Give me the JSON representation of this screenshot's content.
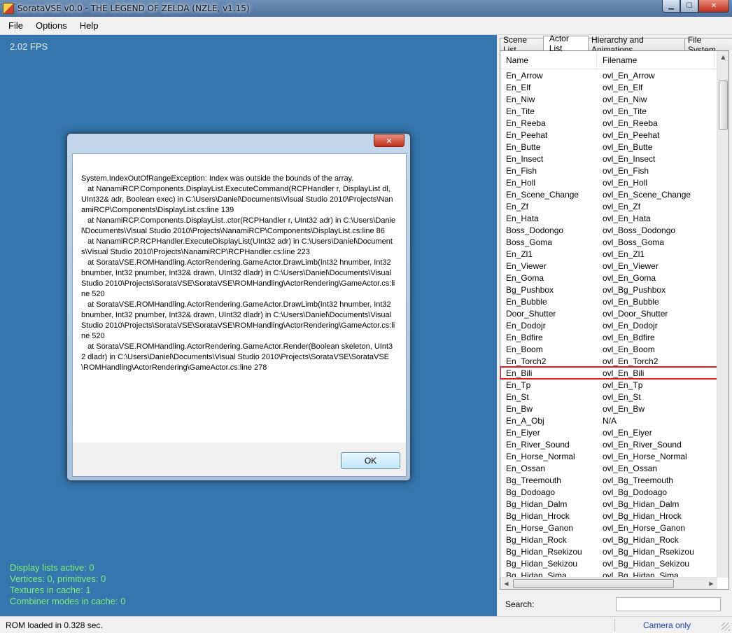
{
  "window": {
    "title": "SorataVSE v0.0 - THE LEGEND OF ZELDA (NZLE, v1.15)"
  },
  "menu": [
    "File",
    "Options",
    "Help"
  ],
  "viewport": {
    "fps": "2.02 FPS",
    "stats": [
      "Display lists active: 0",
      "Vertices: 0, primitives: 0",
      "Textures in cache: 1",
      "Combiner modes in cache: 0"
    ]
  },
  "tabs": [
    "Scene List",
    "Actor List",
    "Hierarchy and Animations",
    "File System"
  ],
  "active_tab": "Actor List",
  "actor_list": {
    "columns": [
      "Name",
      "Filename"
    ],
    "highlighted_row": "En_Bili",
    "rows": [
      [
        "En_Arrow",
        "ovl_En_Arrow"
      ],
      [
        "En_Elf",
        "ovl_En_Elf"
      ],
      [
        "En_Niw",
        "ovl_En_Niw"
      ],
      [
        "En_Tite",
        "ovl_En_Tite"
      ],
      [
        "En_Reeba",
        "ovl_En_Reeba"
      ],
      [
        "En_Peehat",
        "ovl_En_Peehat"
      ],
      [
        "En_Butte",
        "ovl_En_Butte"
      ],
      [
        "En_Insect",
        "ovl_En_Insect"
      ],
      [
        "En_Fish",
        "ovl_En_Fish"
      ],
      [
        "En_Holl",
        "ovl_En_Holl"
      ],
      [
        "En_Scene_Change",
        "ovl_En_Scene_Change"
      ],
      [
        "En_Zf",
        "ovl_En_Zf"
      ],
      [
        "En_Hata",
        "ovl_En_Hata"
      ],
      [
        "Boss_Dodongo",
        "ovl_Boss_Dodongo"
      ],
      [
        "Boss_Goma",
        "ovl_Boss_Goma"
      ],
      [
        "En_Zl1",
        "ovl_En_Zl1"
      ],
      [
        "En_Viewer",
        "ovl_En_Viewer"
      ],
      [
        "En_Goma",
        "ovl_En_Goma"
      ],
      [
        "Bg_Pushbox",
        "ovl_Bg_Pushbox"
      ],
      [
        "En_Bubble",
        "ovl_En_Bubble"
      ],
      [
        "Door_Shutter",
        "ovl_Door_Shutter"
      ],
      [
        "En_Dodojr",
        "ovl_En_Dodojr"
      ],
      [
        "En_Bdfire",
        "ovl_En_Bdfire"
      ],
      [
        "En_Boom",
        "ovl_En_Boom"
      ],
      [
        "En_Torch2",
        "ovl_En_Torch2"
      ],
      [
        "En_Bili",
        "ovl_En_Bili"
      ],
      [
        "En_Tp",
        "ovl_En_Tp"
      ],
      [
        "En_St",
        "ovl_En_St"
      ],
      [
        "En_Bw",
        "ovl_En_Bw"
      ],
      [
        "En_A_Obj",
        "N/A"
      ],
      [
        "En_Eiyer",
        "ovl_En_Eiyer"
      ],
      [
        "En_River_Sound",
        "ovl_En_River_Sound"
      ],
      [
        "En_Horse_Normal",
        "ovl_En_Horse_Normal"
      ],
      [
        "En_Ossan",
        "ovl_En_Ossan"
      ],
      [
        "Bg_Treemouth",
        "ovl_Bg_Treemouth"
      ],
      [
        "Bg_Dodoago",
        "ovl_Bg_Dodoago"
      ],
      [
        "Bg_Hidan_Dalm",
        "ovl_Bg_Hidan_Dalm"
      ],
      [
        "Bg_Hidan_Hrock",
        "ovl_Bg_Hidan_Hrock"
      ],
      [
        "En_Horse_Ganon",
        "ovl_En_Horse_Ganon"
      ],
      [
        "Bg_Hidan_Rock",
        "ovl_Bg_Hidan_Rock"
      ],
      [
        "Bg_Hidan_Rsekizou",
        "ovl_Bg_Hidan_Rsekizou"
      ],
      [
        "Bg_Hidan_Sekizou",
        "ovl_Bg_Hidan_Sekizou"
      ],
      [
        "Bg_Hidan_Sima",
        "ovl_Bg_Hidan_Sima"
      ]
    ]
  },
  "search": {
    "label": "Search:",
    "value": ""
  },
  "status": {
    "left": "ROM loaded in 0.328 sec.",
    "right": "Camera only"
  },
  "dialog": {
    "message": "System.IndexOutOfRangeException: Index was outside the bounds of the array.\n   at NanamiRCP.Components.DisplayList.ExecuteCommand(RCPHandler r, DisplayList dl, UInt32& adr, Boolean exec) in C:\\Users\\Daniel\\Documents\\Visual Studio 2010\\Projects\\NanamiRCP\\Components\\DisplayList.cs:line 139\n   at NanamiRCP.Components.DisplayList..ctor(RCPHandler r, UInt32 adr) in C:\\Users\\Daniel\\Documents\\Visual Studio 2010\\Projects\\NanamiRCP\\Components\\DisplayList.cs:line 86\n   at NanamiRCP.RCPHandler.ExecuteDisplayList(UInt32 adr) in C:\\Users\\Daniel\\Documents\\Visual Studio 2010\\Projects\\NanamiRCP\\RCPHandler.cs:line 223\n   at SorataVSE.ROMHandling.ActorRendering.GameActor.DrawLimb(Int32 hnumber, Int32 bnumber, Int32 pnumber, Int32& drawn, UInt32 dladr) in C:\\Users\\Daniel\\Documents\\Visual Studio 2010\\Projects\\SorataVSE\\SorataVSE\\ROMHandling\\ActorRendering\\GameActor.cs:line 520\n   at SorataVSE.ROMHandling.ActorRendering.GameActor.DrawLimb(Int32 hnumber, Int32 bnumber, Int32 pnumber, Int32& drawn, UInt32 dladr) in C:\\Users\\Daniel\\Documents\\Visual Studio 2010\\Projects\\SorataVSE\\SorataVSE\\ROMHandling\\ActorRendering\\GameActor.cs:line 520\n   at SorataVSE.ROMHandling.ActorRendering.GameActor.Render(Boolean skeleton, UInt32 dladr) in C:\\Users\\Daniel\\Documents\\Visual Studio 2010\\Projects\\SorataVSE\\SorataVSE\\ROMHandling\\ActorRendering\\GameActor.cs:line 278",
    "ok_label": "OK"
  },
  "icons": {
    "app": "app-icon",
    "minimize": "minimize-icon",
    "maximize": "maximize-icon",
    "close": "close-icon"
  },
  "colors": {
    "viewport_bg": "#3476ad",
    "stats_text": "#7ff27a",
    "highlight": "#e02020",
    "status_right": "#1b3fb8"
  }
}
